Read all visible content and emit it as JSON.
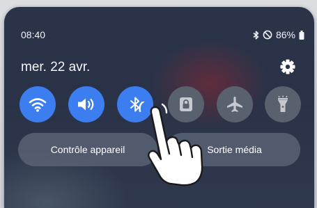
{
  "status_bar": {
    "time": "08:40",
    "battery": "86%",
    "icons": [
      "bluetooth-icon",
      "do-not-disturb-icon",
      "battery-icon"
    ]
  },
  "header": {
    "date": "mer. 22 avr.",
    "settings_icon": "gear-icon"
  },
  "quick_toggles": [
    {
      "icon": "wifi-icon",
      "on": true
    },
    {
      "icon": "sound-icon",
      "on": true
    },
    {
      "icon": "bluetooth-icon",
      "on": true
    },
    {
      "icon": "lock-icon",
      "on": false
    },
    {
      "icon": "airplane-icon",
      "on": false
    },
    {
      "icon": "flashlight-icon",
      "on": false
    }
  ],
  "buttons": {
    "device_control": "Contrôle appareil",
    "media_output": "Sortie média"
  },
  "colors": {
    "accent": "#3c7df0",
    "tile_off": "#59606e",
    "panel": "#2b3349"
  }
}
